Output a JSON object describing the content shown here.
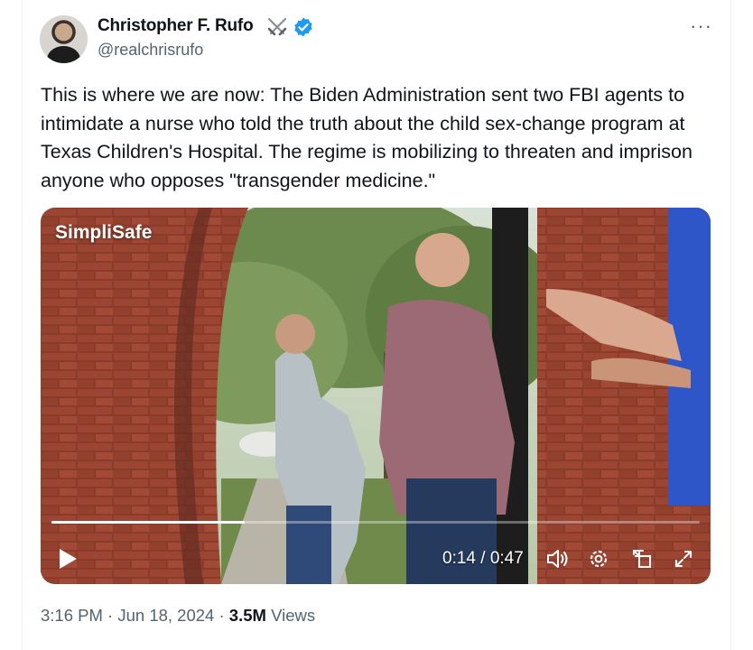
{
  "author": {
    "name": "Christopher F. Rufo",
    "handle": "@realchrisrufo",
    "badge_icon": "crossed-swords-icon",
    "verified_color": "#1d9bf0"
  },
  "more_label": "···",
  "tweet": {
    "text": "This is where we are now: The Biden Administration sent two FBI agents to intimidate a nurse who told the truth about the child sex-change program at Texas Children's Hospital. The regime is mobilizing to threaten and imprison anyone who opposes \"transgender medicine.\""
  },
  "video": {
    "watermark": "SimpliSafe",
    "current_time": "0:14",
    "duration": "0:47",
    "time_display": "0:14 / 0:47",
    "progress_fraction": 0.298,
    "controls": [
      "play-icon",
      "volume-icon",
      "settings-icon",
      "pip-icon",
      "fullscreen-icon"
    ]
  },
  "meta": {
    "time": "3:16 PM",
    "date": "Jun 18, 2024",
    "views_count": "3.5M",
    "views_label": "Views"
  }
}
